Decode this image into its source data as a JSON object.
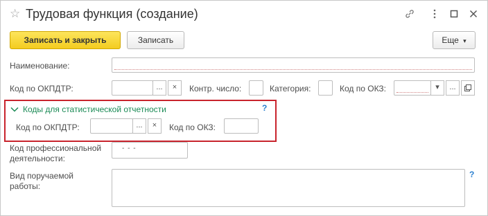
{
  "window": {
    "title": "Трудовая функция (создание)"
  },
  "toolbar": {
    "save_close_label": "Записать и закрыть",
    "save_label": "Записать",
    "more_label": "Еще"
  },
  "form": {
    "name_label": "Наименование:",
    "okpdtr_label": "Код по ОКПДТР:",
    "control_label": "Контр. число:",
    "category_label": "Категория:",
    "okz_label": "Код по ОКЗ:",
    "stat_group_label": "Коды для статистической отчетности",
    "stat_okpdtr_label": "Код по ОКПДТР:",
    "stat_okz_label": "Код по ОКЗ:",
    "prof_label_line1": "Код профессиональной",
    "prof_label_line2": "деятельности:",
    "prof_value": "- - -",
    "work_label_line1": "Вид поручаемой",
    "work_label_line2": "работы:",
    "help_symbol": "?",
    "clear_symbol": "×",
    "more_symbol": "...",
    "dropdown_symbol": "▾"
  },
  "colors": {
    "accent_yellow": "#f3cc1f",
    "group_green": "#1a8a55",
    "highlight_red": "#c8232c",
    "help_blue": "#2a7fcf"
  },
  "icons": [
    "star-icon",
    "link-icon",
    "more-vertical-icon",
    "maximize-icon",
    "close-icon",
    "chevron-down-icon",
    "open-icon"
  ]
}
